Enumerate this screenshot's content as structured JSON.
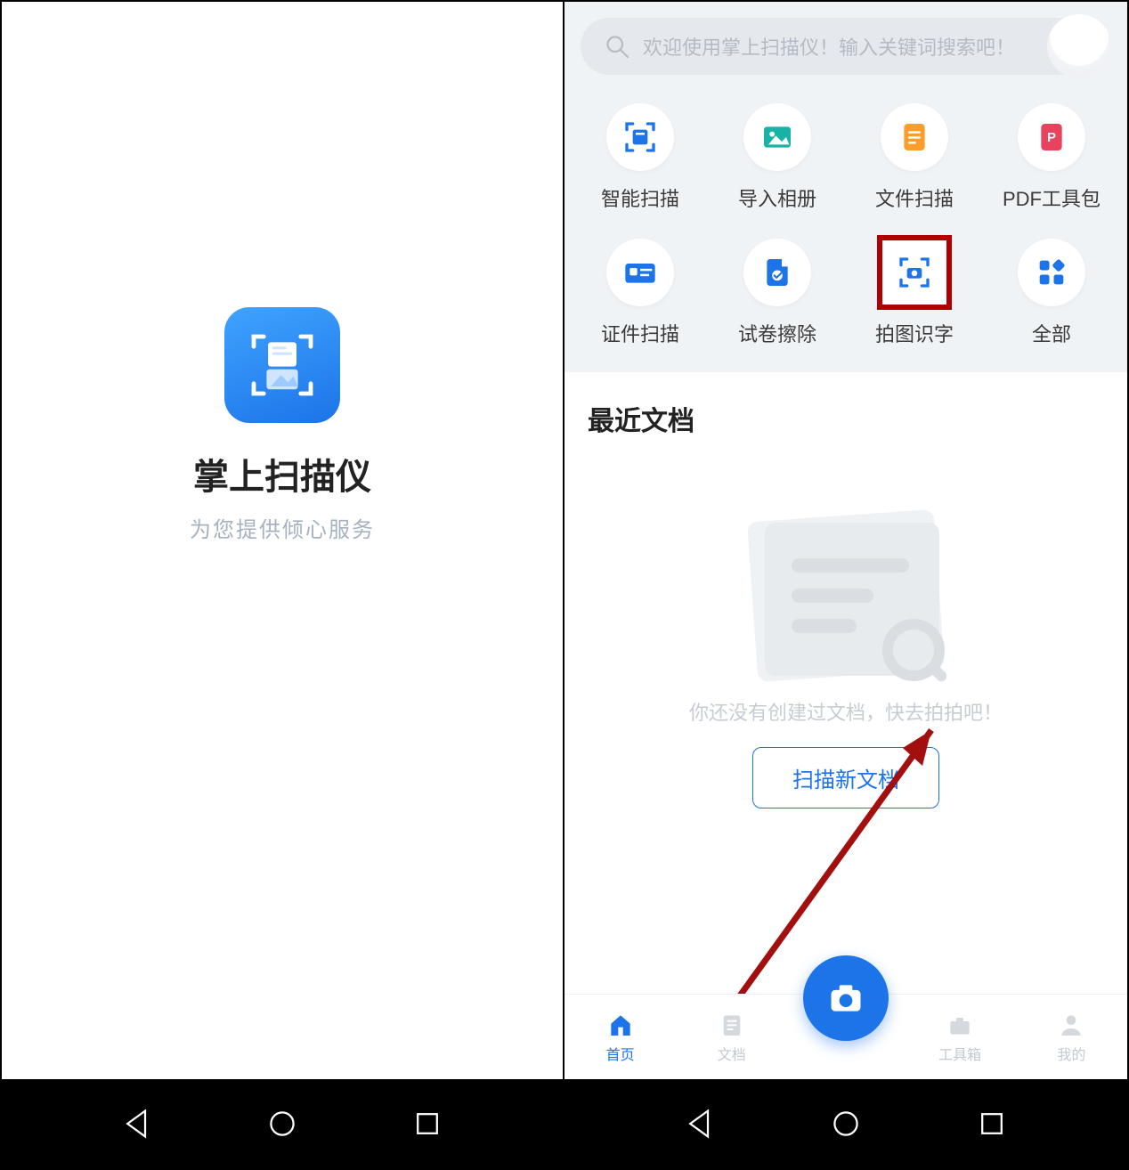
{
  "colors": {
    "accent": "#1c74e8",
    "highlight": "#b00000"
  },
  "left": {
    "app_title": "掌上扫描仪",
    "app_subtitle": "为您提供倾心服务"
  },
  "right": {
    "search_placeholder": "欢迎使用掌上扫描仪！输入关键词搜索吧！",
    "grid": [
      {
        "label": "智能扫描"
      },
      {
        "label": "导入相册"
      },
      {
        "label": "文件扫描"
      },
      {
        "label": "PDF工具包"
      },
      {
        "label": "证件扫描"
      },
      {
        "label": "试卷擦除"
      },
      {
        "label": "拍图识字"
      },
      {
        "label": "全部"
      }
    ],
    "highlighted_index": 6,
    "section_title": "最近文档",
    "empty_text": "你还没有创建过文档，快去拍拍吧！",
    "scan_button": "扫描新文档",
    "tabs": [
      {
        "label": "首页",
        "active": true
      },
      {
        "label": "文档",
        "active": false
      },
      {
        "label": "工具箱",
        "active": false
      },
      {
        "label": "我的",
        "active": false
      }
    ]
  }
}
